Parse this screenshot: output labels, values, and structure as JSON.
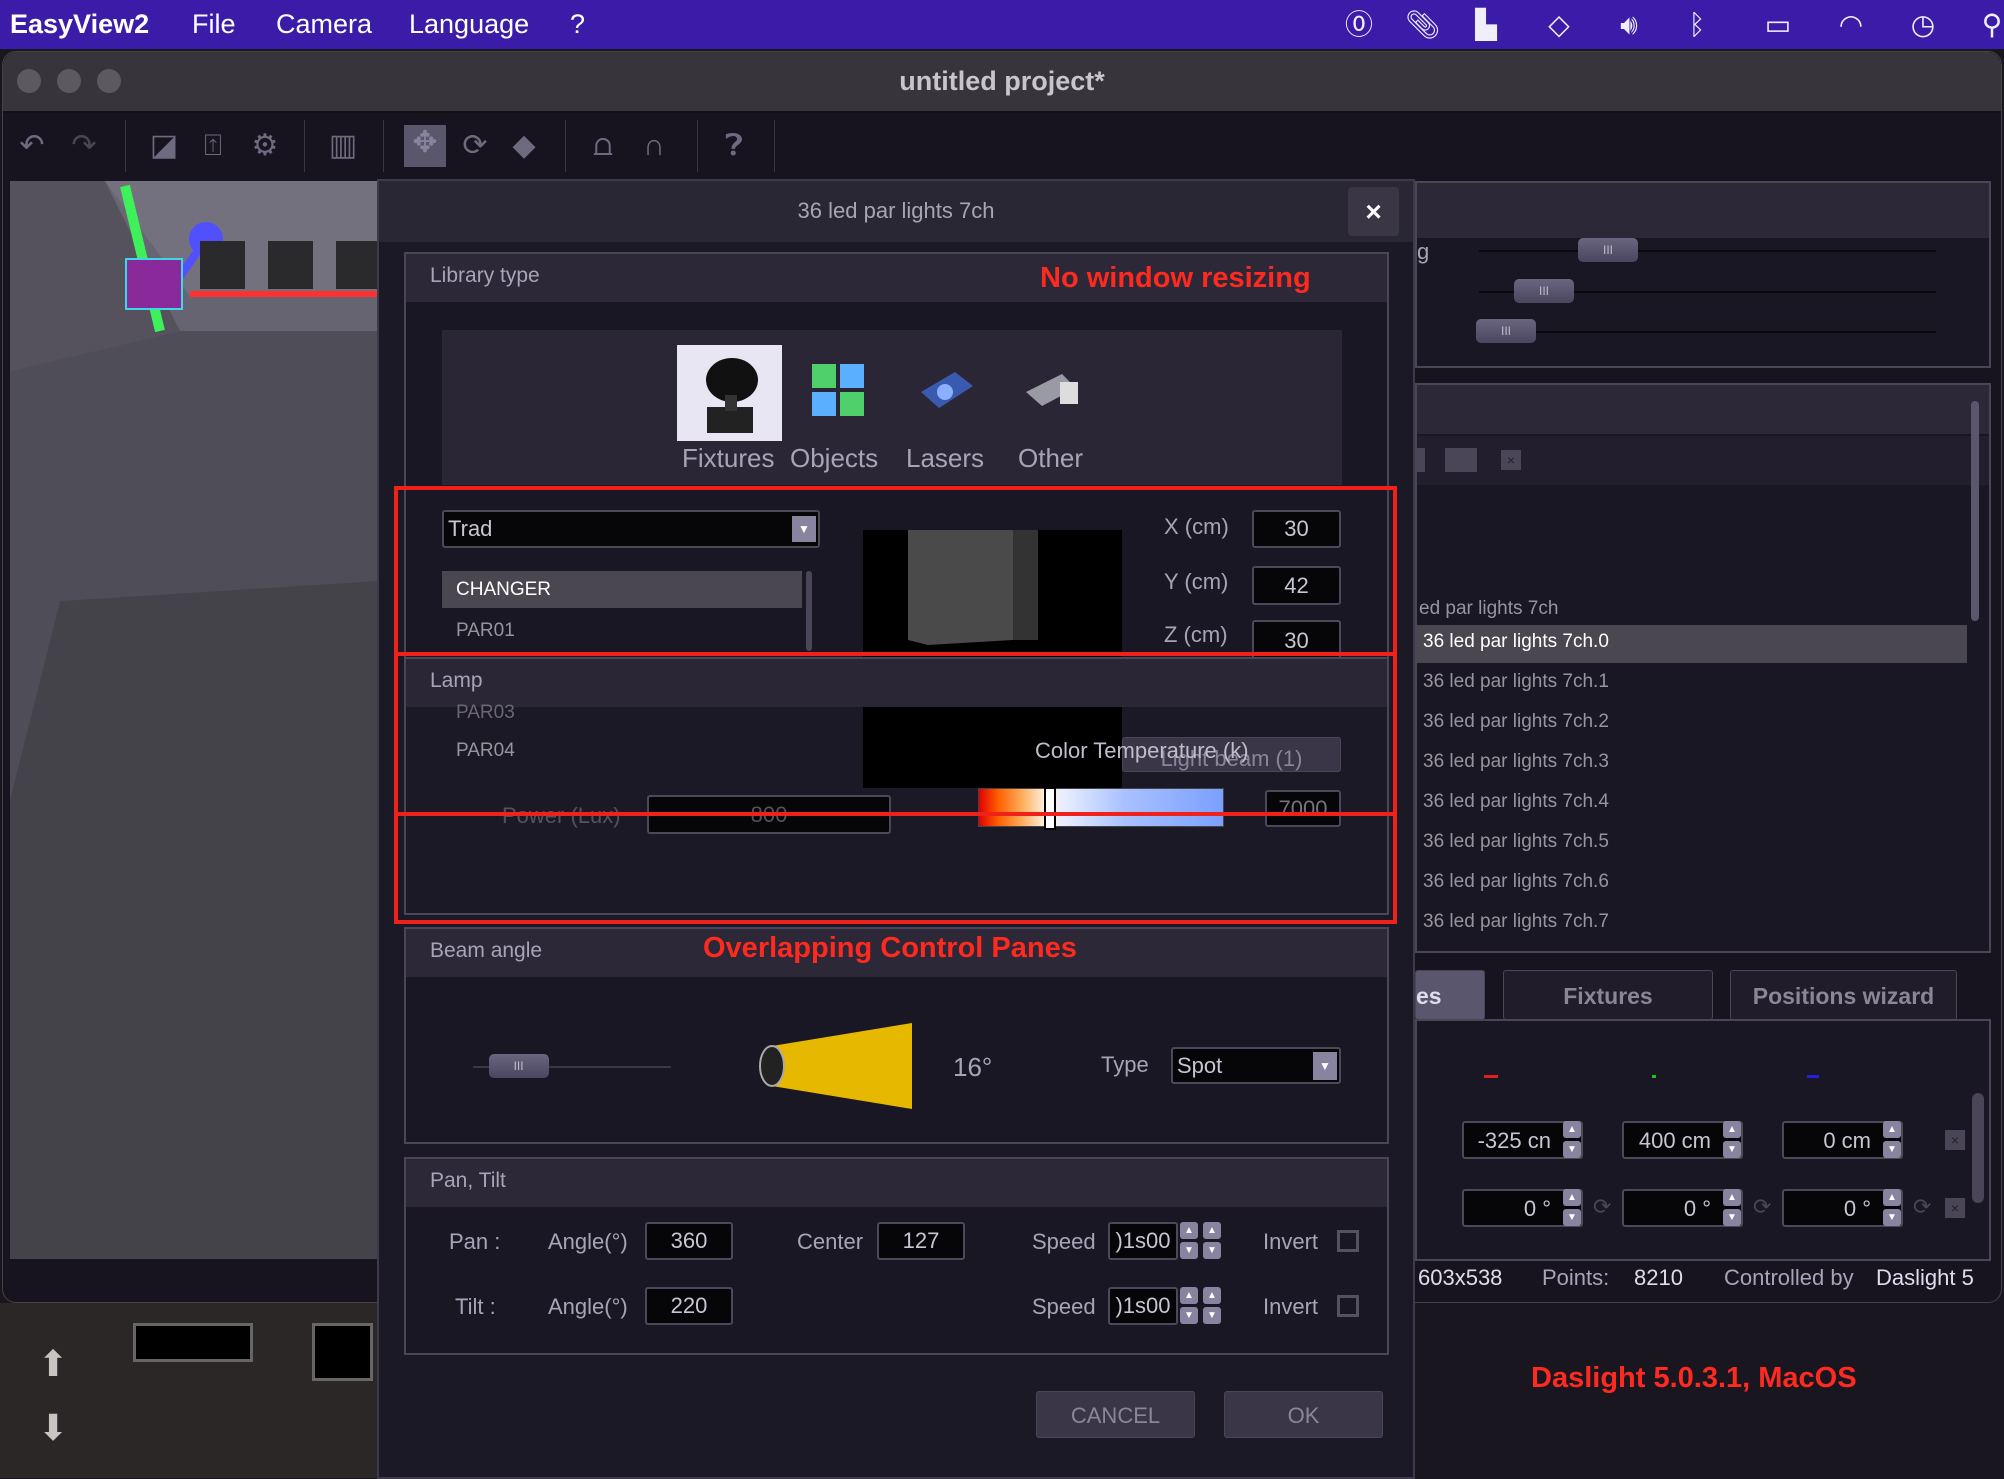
{
  "menubar": {
    "app": "EasyView2",
    "items": [
      "File",
      "Camera",
      "Language",
      "?"
    ],
    "status_icons": [
      "onepassword-icon",
      "paperclip-icon",
      "layout-icon",
      "diamond-icon",
      "volume-icon",
      "bluetooth-icon",
      "battery-charging-icon",
      "wifi-icon",
      "time-machine-icon",
      "search-icon"
    ]
  },
  "window": {
    "title": "untitled project*"
  },
  "toolbar": {
    "icons": [
      "undo-icon",
      "redo-icon",
      "new-icon",
      "export-icon",
      "settings-icon",
      "stats-icon",
      "move-icon",
      "rotate-icon",
      "diamond-icon",
      "truss-icon",
      "magnet-icon",
      "help-icon"
    ]
  },
  "dialog": {
    "title": "36 led par lights 7ch",
    "close": "×",
    "library": {
      "header": "Library type",
      "types": [
        "Fixtures",
        "Objects",
        "Lasers",
        "Other"
      ],
      "selected": "Fixtures"
    },
    "fixture": {
      "category": "Trad",
      "list": [
        "CHANGER",
        "PAR01",
        "PAR03",
        "PAR04"
      ],
      "selected": "CHANGER",
      "x_label": "X (cm)",
      "x": "30",
      "y_label": "Y (cm)",
      "y": "42",
      "z_label": "Z (cm)",
      "z": "30"
    },
    "lamp": {
      "header": "Lamp",
      "color_temp_label": "Color Temperature (k)",
      "light_beam_button": "Light beam (1)",
      "power_label": "Power (Lux)",
      "power": "800",
      "color_temp": "7000",
      "color_temp_position": 0.29
    },
    "beam": {
      "header": "Beam angle",
      "angle": "16°",
      "slider_value": 0.2,
      "type_label": "Type",
      "type": "Spot",
      "beam_color": "#e6b800"
    },
    "pantilt": {
      "header": "Pan, Tilt",
      "pan": {
        "label": "Pan :",
        "angle_label": "Angle(°)",
        "angle": "360",
        "center_label": "Center",
        "center": "127",
        "speed_label": "Speed",
        "speed": ")1s00",
        "invert_label": "Invert",
        "invert": false
      },
      "tilt": {
        "label": "Tilt :",
        "angle_label": "Angle(°)",
        "angle": "220",
        "speed_label": "Speed",
        "speed": ")1s00",
        "invert_label": "Invert",
        "invert": false
      }
    },
    "cancel": "CANCEL",
    "ok": "OK"
  },
  "annotations": {
    "a1": "No window resizing",
    "a2": "Overlapping Control Panes",
    "a3": "Daslight 5.0.3.1, MacOS",
    "color": "#f0201a"
  },
  "right": {
    "slider_label_partial": "g",
    "sliders": [
      0.2,
      0.07,
      0.0
    ],
    "tree_parent": "ed par lights 7ch",
    "items": [
      "36 led par lights 7ch.0",
      "36 led par lights 7ch.1",
      "36 led par lights 7ch.2",
      "36 led par lights 7ch.3",
      "36 led par lights 7ch.4",
      "36 led par lights 7ch.5",
      "36 led par lights 7ch.6",
      "36 led par lights 7ch.7"
    ],
    "selected_index": 0,
    "tabs": [
      "es",
      "Fixtures",
      "Positions wizard"
    ],
    "position": [
      "-325 cn",
      "400 cm",
      "0 cm"
    ],
    "rotation": [
      "0 °",
      "0 °",
      "0 °"
    ],
    "status": {
      "resolution": "603x538",
      "points_label": "Points:",
      "points": "8210",
      "controlled_label": "Controlled by",
      "controlled": "Daslight 5"
    }
  }
}
